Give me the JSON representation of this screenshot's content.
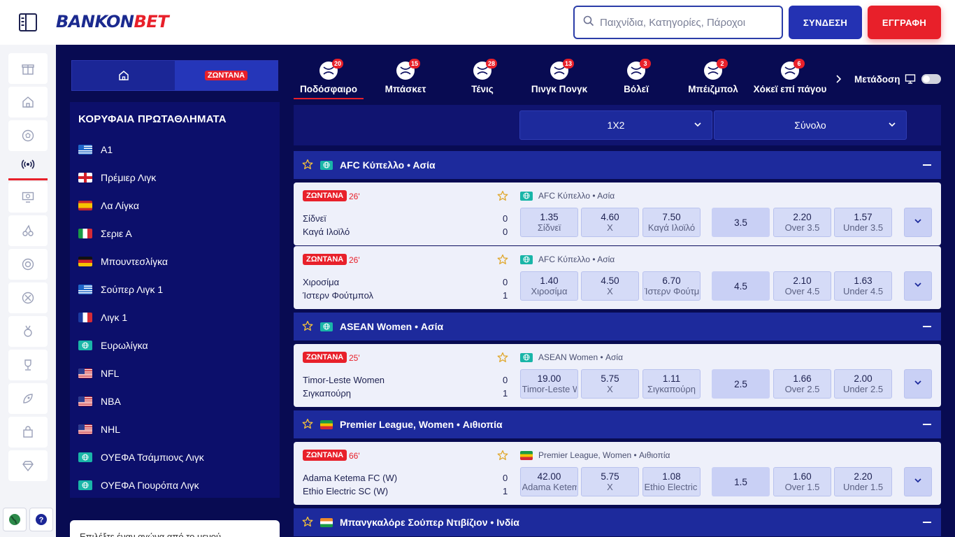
{
  "header": {
    "logo_part1": "BANKON",
    "logo_part2": "BET",
    "search_placeholder": "Παιχνίδια, Κατηγορίες, Πάροχοι",
    "login_label": "ΣΥΝΔΕΣΗ",
    "register_label": "ΕΓΓΡΑΦΗ"
  },
  "rail": {
    "icons": [
      "gift-icon",
      "home-icon",
      "soccer-icon",
      "live-broadcast-icon",
      "virtual-monitor-icon",
      "cherries-icon",
      "roulette-icon",
      "poker-chip-icon",
      "medal-icon",
      "trophy-icon",
      "rocket-icon",
      "shopping-bag-icon",
      "diamond-icon"
    ],
    "bottom": [
      "globe-icon",
      "help-icon"
    ]
  },
  "left_panel": {
    "live_tab_label": "ΖΩΝΤΑΝΑ",
    "title": "ΚΟΡΥΦΑΙΑ ΠΡΩΤΑΘΛΗΜΑΤΑ",
    "leagues": [
      {
        "name": "A1",
        "flag": "gr"
      },
      {
        "name": "Πρέμιερ Λιγκ",
        "flag": "en"
      },
      {
        "name": "Λα Λίγκα",
        "flag": "es"
      },
      {
        "name": "Σεριε Α",
        "flag": "it"
      },
      {
        "name": "Μπουντεσλίγκα",
        "flag": "de"
      },
      {
        "name": "Σούπερ Λιγκ 1",
        "flag": "gr"
      },
      {
        "name": "Λιγκ 1",
        "flag": "fr"
      },
      {
        "name": "Ευρωλίγκα",
        "flag": "world"
      },
      {
        "name": "NFL",
        "flag": "us"
      },
      {
        "name": "NBA",
        "flag": "us"
      },
      {
        "name": "NHL",
        "flag": "us"
      },
      {
        "name": "ΟΥΕΦΑ Τσάμπιονς Λιγκ",
        "flag": "world"
      },
      {
        "name": "ΟΥΕΦΑ Γιουρόπα Λιγκ",
        "flag": "world"
      }
    ],
    "bottom_text": "Επιλέξτε έναν αγώνα από το μενού"
  },
  "sports": [
    {
      "label": "Ποδόσφαιρο",
      "count": "20",
      "icon": "soccer-ball-icon"
    },
    {
      "label": "Μπάσκετ",
      "count": "15",
      "icon": "basketball-icon"
    },
    {
      "label": "Τένις",
      "count": "28",
      "icon": "tennis-ball-icon"
    },
    {
      "label": "Πινγκ Πονγκ",
      "count": "13",
      "icon": "ping-pong-icon"
    },
    {
      "label": "Βόλεϊ",
      "count": "3",
      "icon": "volleyball-icon"
    },
    {
      "label": "Μπέιζμπολ",
      "count": "2",
      "icon": "baseball-icon"
    },
    {
      "label": "Χόκεϊ επί πάγου",
      "count": "6",
      "icon": "ice-hockey-icon"
    }
  ],
  "stream_label": "Μετάδοση",
  "markets": {
    "first": "1X2",
    "second": "Σύνολο"
  },
  "sections": [
    {
      "title": "AFC Κύπελλο • Ασία",
      "flag": "world"
    },
    {
      "title": "ASEAN Women • Ασία",
      "flag": "world"
    },
    {
      "title": "Premier League, Women • Αιθιοπία",
      "flag": "et"
    },
    {
      "title": "Μπανγκαλόρε Σούπερ Ντιβίζιον • Ινδία",
      "flag": "in"
    }
  ],
  "matches": [
    {
      "live": "ΖΩΝΤΑΝΑ",
      "minute": "26'",
      "comp": "AFC Κύπελλο • Ασία",
      "home": "Σίδνεϊ",
      "away": "Καγά Ιλοϊλό",
      "home_score": "0",
      "away_score": "0",
      "odds": [
        {
          "v": "1.35",
          "n": "Σίδνεϊ"
        },
        {
          "v": "4.60",
          "n": "X"
        },
        {
          "v": "7.50",
          "n": "Καγά Ιλοϊλό"
        }
      ],
      "line": "3.5",
      "totals": [
        {
          "v": "2.20",
          "n": "Over 3.5"
        },
        {
          "v": "1.57",
          "n": "Under 3.5"
        }
      ]
    },
    {
      "live": "ΖΩΝΤΑΝΑ",
      "minute": "26'",
      "comp": "AFC Κύπελλο • Ασία",
      "home": "Χιροσίμα",
      "away": "Ίστερν Φούτμπολ",
      "home_score": "0",
      "away_score": "1",
      "odds": [
        {
          "v": "1.40",
          "n": "Χιροσίμα"
        },
        {
          "v": "4.50",
          "n": "X"
        },
        {
          "v": "6.70",
          "n": "Ίστερν Φούτμπολ"
        }
      ],
      "line": "4.5",
      "totals": [
        {
          "v": "2.10",
          "n": "Over 4.5"
        },
        {
          "v": "1.63",
          "n": "Under 4.5"
        }
      ]
    },
    {
      "live": "ΖΩΝΤΑΝΑ",
      "minute": "25'",
      "comp": "ASEAN Women • Ασία",
      "home": "Timor-Leste Women",
      "away": "Σιγκαπούρη",
      "home_score": "0",
      "away_score": "1",
      "odds": [
        {
          "v": "19.00",
          "n": "Timor-Leste Women"
        },
        {
          "v": "5.75",
          "n": "X"
        },
        {
          "v": "1.11",
          "n": "Σιγκαπούρη"
        }
      ],
      "line": "2.5",
      "totals": [
        {
          "v": "1.66",
          "n": "Over 2.5"
        },
        {
          "v": "2.00",
          "n": "Under 2.5"
        }
      ]
    },
    {
      "live": "ΖΩΝΤΑΝΑ",
      "minute": "66'",
      "comp": "Premier League, Women • Αιθιοπία",
      "home": "Adama Ketema FC (W)",
      "away": "Ethio Electric SC (W)",
      "home_score": "0",
      "away_score": "1",
      "odds": [
        {
          "v": "42.00",
          "n": "Adama Ketema FC (W)"
        },
        {
          "v": "5.75",
          "n": "X"
        },
        {
          "v": "1.08",
          "n": "Ethio Electric SC (W)"
        }
      ],
      "line": "1.5",
      "totals": [
        {
          "v": "1.60",
          "n": "Over 1.5"
        },
        {
          "v": "2.20",
          "n": "Under 1.5"
        }
      ]
    }
  ]
}
